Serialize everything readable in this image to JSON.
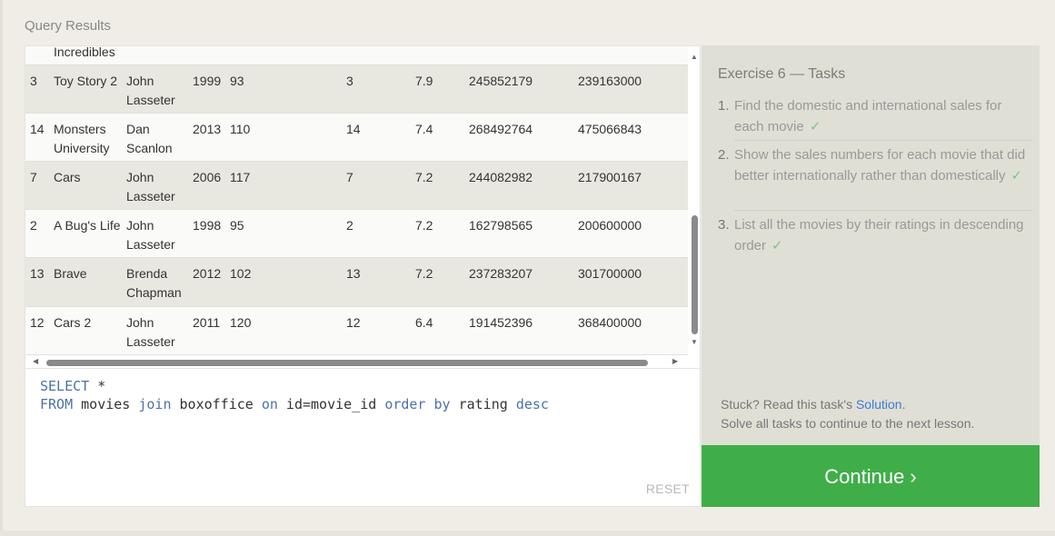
{
  "results_title": "Query Results",
  "partial_top_row": "Incredibles",
  "rows": [
    {
      "id": "3",
      "title": "Toy Story 2",
      "director": "John Lasseter",
      "year": "1999",
      "length": "93",
      "movie_id": "3",
      "rating": "7.9",
      "domestic": "245852179",
      "international": "239163000"
    },
    {
      "id": "14",
      "title": "Monsters University",
      "director": "Dan Scanlon",
      "year": "2013",
      "length": "110",
      "movie_id": "14",
      "rating": "7.4",
      "domestic": "268492764",
      "international": "475066843"
    },
    {
      "id": "7",
      "title": "Cars",
      "director": "John Lasseter",
      "year": "2006",
      "length": "117",
      "movie_id": "7",
      "rating": "7.2",
      "domestic": "244082982",
      "international": "217900167"
    },
    {
      "id": "2",
      "title": "A Bug's Life",
      "director": "John Lasseter",
      "year": "1998",
      "length": "95",
      "movie_id": "2",
      "rating": "7.2",
      "domestic": "162798565",
      "international": "200600000"
    },
    {
      "id": "13",
      "title": "Brave",
      "director": "Brenda Chapman",
      "year": "2012",
      "length": "102",
      "movie_id": "13",
      "rating": "7.2",
      "domestic": "237283207",
      "international": "301700000"
    },
    {
      "id": "12",
      "title": "Cars 2",
      "director": "John Lasseter",
      "year": "2011",
      "length": "120",
      "movie_id": "12",
      "rating": "6.4",
      "domestic": "191452396",
      "international": "368400000"
    }
  ],
  "editor": {
    "line1_kw": "SELECT",
    "line1_rest": " *",
    "line2": [
      {
        "t": "FROM",
        "kw": true
      },
      {
        "t": " movies ",
        "kw": false
      },
      {
        "t": "join",
        "kw": true
      },
      {
        "t": " boxoffice ",
        "kw": false
      },
      {
        "t": "on",
        "kw": true
      },
      {
        "t": " id=movie_id ",
        "kw": false
      },
      {
        "t": "order by",
        "kw": true
      },
      {
        "t": " rating ",
        "kw": false
      },
      {
        "t": "desc",
        "kw": true
      }
    ],
    "reset_label": "RESET"
  },
  "tasks": {
    "title": "Exercise 6 — Tasks",
    "items": [
      {
        "num": "1.",
        "text": "Find the domestic and international sales for each movie",
        "done": "✓"
      },
      {
        "num": "2.",
        "text": "Show the sales numbers for each movie that did better internationally rather than domestically",
        "done": "✓"
      },
      {
        "num": "3.",
        "text": "List all the movies by their ratings in descending order",
        "done": "✓"
      }
    ],
    "stuck_prefix": "Stuck? Read this task's ",
    "solution_label": "Solution",
    "stuck_suffix": ".",
    "solve_all": "Solve all tasks to continue to the next lesson."
  },
  "continue_label": "Continue ›"
}
